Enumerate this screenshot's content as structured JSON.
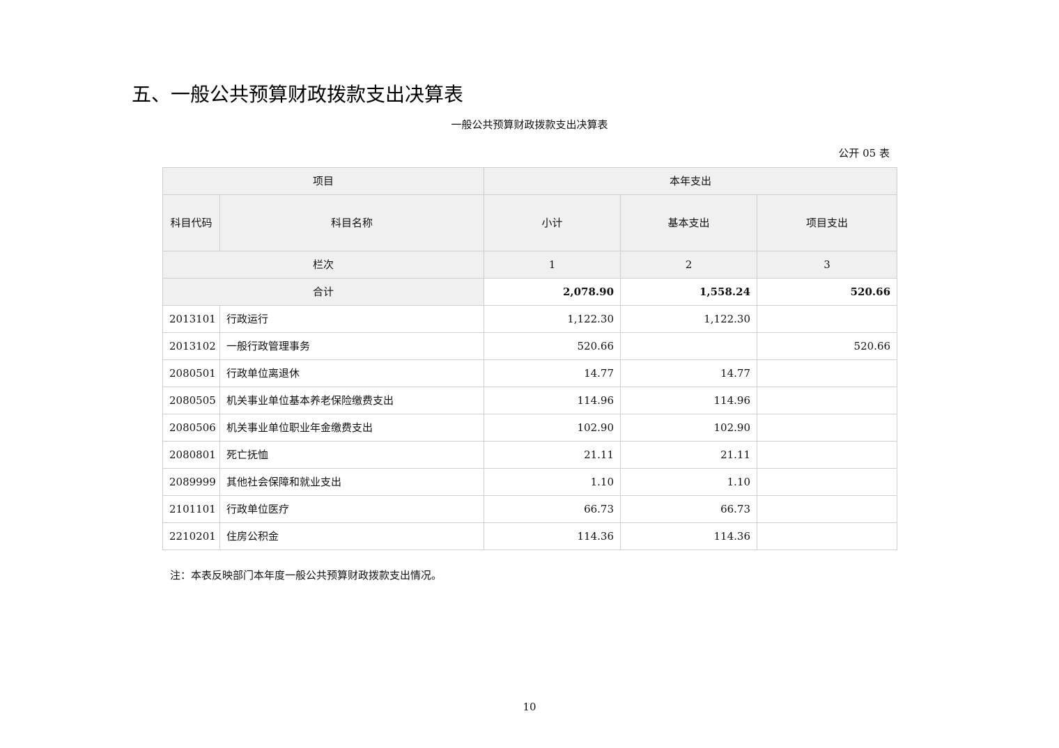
{
  "heading": "五、一般公共预算财政拨款支出决算表",
  "table_title": "一般公共预算财政拨款支出决算表",
  "form_number": "公开 05 表",
  "header": {
    "project": "项目",
    "current_year_expenditure": "本年支出",
    "subject_code": "科目代码",
    "subject_name": "科目名称",
    "subtotal": "小计",
    "basic_expenditure": "基本支出",
    "project_expenditure": "项目支出",
    "column_index_label": "栏次",
    "col1": "1",
    "col2": "2",
    "col3": "3"
  },
  "total": {
    "label": "合计",
    "subtotal": "2,078.90",
    "basic": "1,558.24",
    "project": "520.66"
  },
  "rows": [
    {
      "code": "2013101",
      "name": "行政运行",
      "subtotal": "1,122.30",
      "basic": "1,122.30",
      "project": ""
    },
    {
      "code": "2013102",
      "name": "一般行政管理事务",
      "subtotal": "520.66",
      "basic": "",
      "project": "520.66"
    },
    {
      "code": "2080501",
      "name": "行政单位离退休",
      "subtotal": "14.77",
      "basic": "14.77",
      "project": ""
    },
    {
      "code": "2080505",
      "name": "机关事业单位基本养老保险缴费支出",
      "subtotal": "114.96",
      "basic": "114.96",
      "project": ""
    },
    {
      "code": "2080506",
      "name": "机关事业单位职业年金缴费支出",
      "subtotal": "102.90",
      "basic": "102.90",
      "project": ""
    },
    {
      "code": "2080801",
      "name": "死亡抚恤",
      "subtotal": "21.11",
      "basic": "21.11",
      "project": ""
    },
    {
      "code": "2089999",
      "name": "其他社会保障和就业支出",
      "subtotal": "1.10",
      "basic": "1.10",
      "project": ""
    },
    {
      "code": "2101101",
      "name": "行政单位医疗",
      "subtotal": "66.73",
      "basic": "66.73",
      "project": ""
    },
    {
      "code": "2210201",
      "name": "住房公积金",
      "subtotal": "114.36",
      "basic": "114.36",
      "project": ""
    }
  ],
  "footnote": "注：本表反映部门本年度一般公共预算财政拨款支出情况。",
  "page_number": "10"
}
